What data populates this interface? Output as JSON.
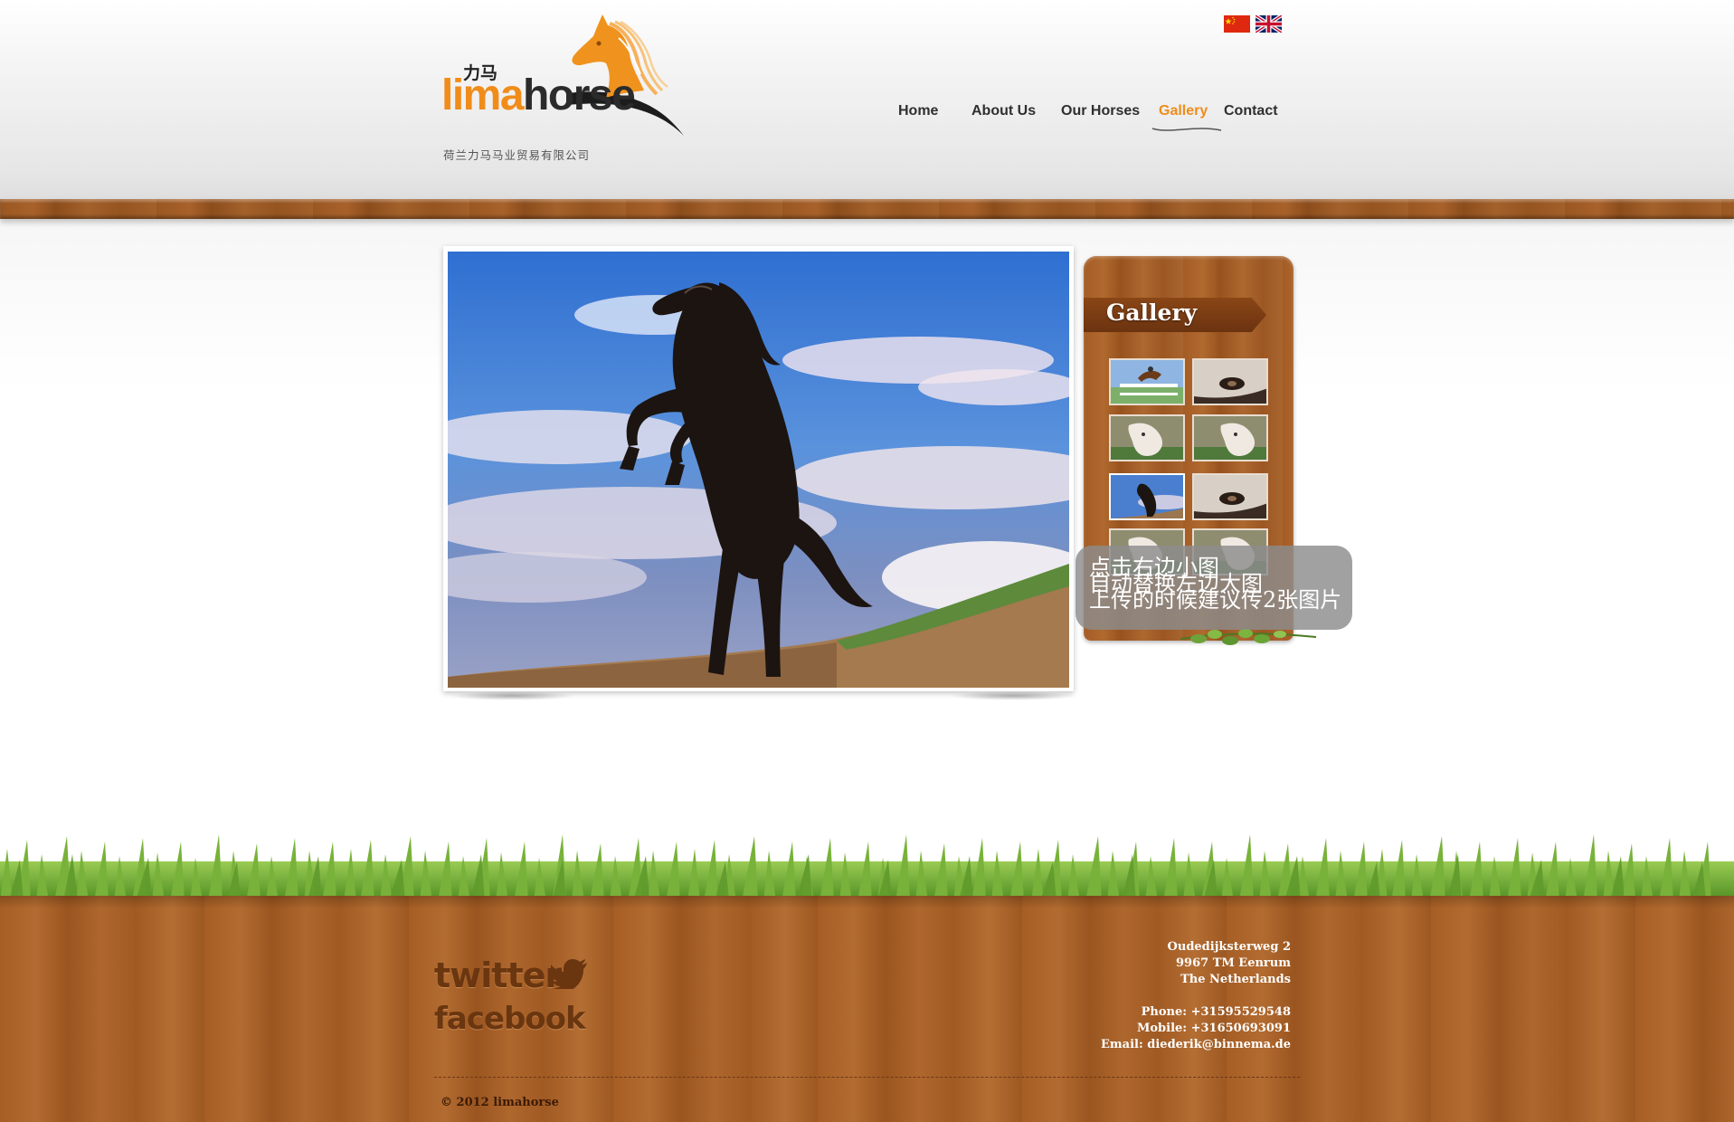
{
  "brand": {
    "logo_cn": "力马",
    "logo_lima": "lima",
    "logo_horse": "horse",
    "company_cn": "荷兰力马马业贸易有限公司",
    "accent_color": "#f08c1a"
  },
  "flags": [
    {
      "name": "china-flag-icon"
    },
    {
      "name": "uk-flag-icon"
    }
  ],
  "nav": {
    "items": [
      {
        "label": "Home",
        "active": false
      },
      {
        "label": "About Us",
        "active": false
      },
      {
        "label": "Our Horses",
        "active": false
      },
      {
        "label": "Gallery",
        "active": true
      },
      {
        "label": "Contact",
        "active": false
      }
    ]
  },
  "gallery": {
    "title": "Gallery",
    "selected_index": 4,
    "thumbnails": [
      "show-jumping",
      "horse-eye",
      "white-horse",
      "white-horse",
      "rearing-black-horse",
      "horse-eye",
      "white-horse",
      "white-horse"
    ]
  },
  "tooltip": {
    "line1": "点击右边小图",
    "line2": "自动替换左边大图",
    "line3": "上传的时候建议传2张图片"
  },
  "footer": {
    "twitter_label": "twitter",
    "facebook_label": "facebook",
    "address_line1": "Oudedijksterweg 2",
    "address_line2": "9967 TM Eenrum",
    "address_line3": "The Netherlands",
    "phone": "Phone: +31595529548",
    "mobile": "Mobile: +31650693091",
    "email": "Email: diederik@binnema.de",
    "copyright": "© 2012 limahorse"
  }
}
